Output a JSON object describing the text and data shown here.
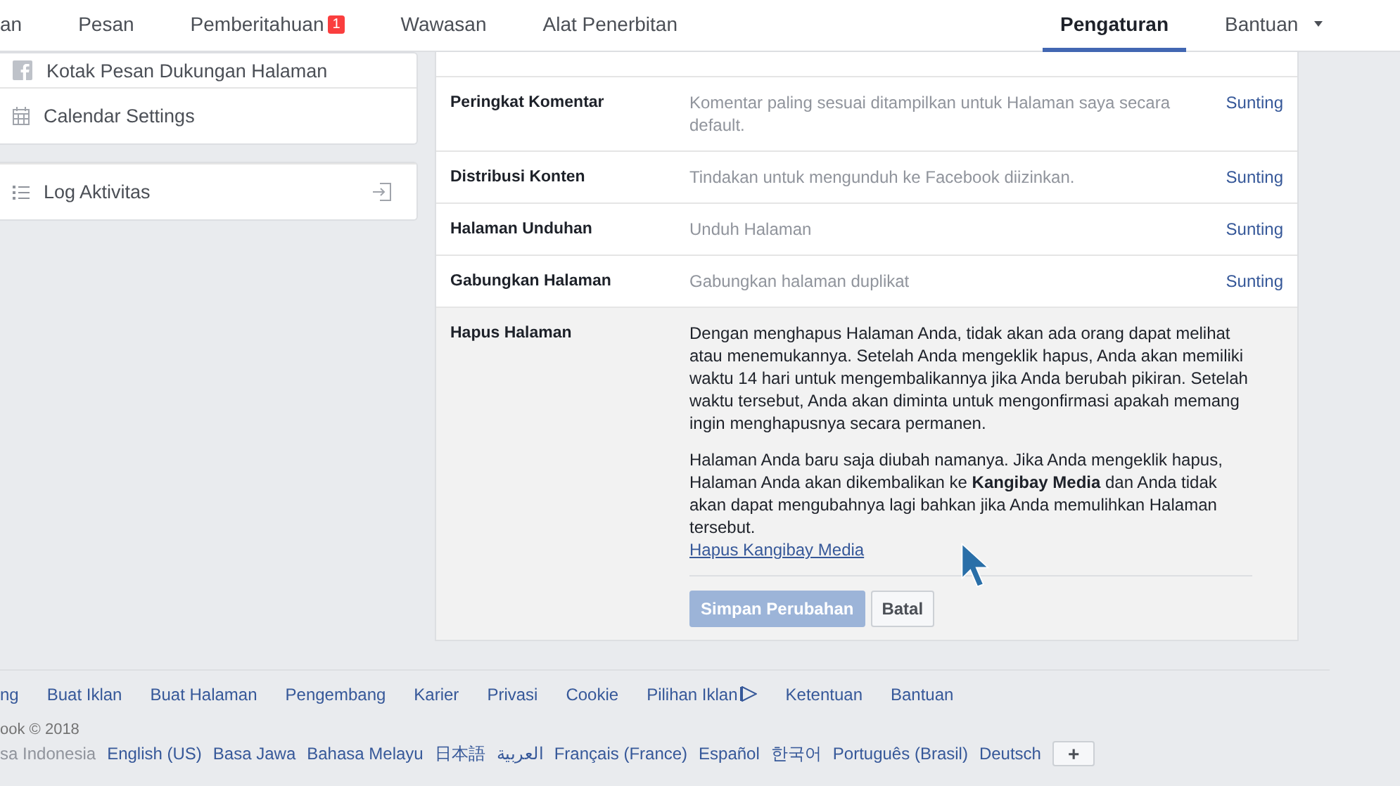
{
  "header": {
    "tabs": [
      {
        "label": "an",
        "selected": false,
        "kind": "link"
      },
      {
        "label": "Pesan",
        "selected": false,
        "kind": "link"
      },
      {
        "label": "Pemberitahuan",
        "selected": false,
        "kind": "link",
        "badge": "1"
      },
      {
        "label": "Wawasan",
        "selected": false,
        "kind": "link"
      },
      {
        "label": "Alat Penerbitan",
        "selected": false,
        "kind": "link"
      },
      {
        "label": "Pengaturan",
        "selected": true,
        "kind": "link"
      },
      {
        "label": "Bantuan",
        "selected": false,
        "kind": "dropdown"
      }
    ]
  },
  "sidebar": {
    "cards": [
      [
        {
          "label": "Kotak Pesan Dukungan Halaman"
        },
        {
          "label": "Calendar Settings"
        }
      ],
      [
        {
          "label": "Log Aktivitas"
        }
      ]
    ]
  },
  "settings": {
    "rows": [
      {
        "kind": "row",
        "label": "Peringkat Komentar",
        "description": "Komentar paling sesuai ditampilkan untuk Halaman saya secara default.",
        "action": "Sunting"
      },
      {
        "kind": "row",
        "label": "Distribusi Konten",
        "description": "Tindakan untuk mengunduh ke Facebook diizinkan.",
        "action": "Sunting"
      },
      {
        "kind": "row",
        "label": "Halaman Unduhan",
        "description": "Unduh Halaman",
        "action": "Sunting"
      },
      {
        "kind": "row",
        "label": "Gabungkan Halaman",
        "description": "Gabungkan halaman duplikat",
        "action": "Sunting"
      },
      {
        "kind": "expanded",
        "label": "Hapus Halaman",
        "paragraphs": [
          "Dengan menghapus Halaman Anda, tidak akan ada orang dapat melihat atau menemukannya. Setelah Anda mengeklik hapus, Anda akan memiliki waktu 14 hari untuk mengembalikannya jika Anda berubah pikiran. Setelah waktu tersebut, Anda akan diminta untuk mengonfirmasi apakah memang ingin menghapusnya secara permanen.",
          "Halaman Anda baru saja diubah namanya. Jika Anda mengeklik hapus, Halaman Anda akan dikembalikan ke **Kangibay Media** dan Anda tidak akan dapat mengubahnya lagi bahkan jika Anda memulihkan Halaman tersebut."
        ],
        "link": "Hapus Kangibay Media",
        "buttons": [
          {
            "label": "Simpan Perubahan",
            "disabled": true
          },
          {
            "label": "Batal",
            "disabled": false
          }
        ]
      }
    ]
  },
  "footer": {
    "links": [
      "ng",
      "Buat Iklan",
      "Buat Halaman",
      "Pengembang",
      "Karier",
      "Privasi",
      "Cookie",
      "Pilihan Iklan",
      "Ketentuan",
      "Bantuan"
    ],
    "copyright": "ook © 2018",
    "languages": [
      {
        "label": "sa Indonesia",
        "selected": true
      },
      {
        "label": "English (US)",
        "selected": false
      },
      {
        "label": "Basa Jawa",
        "selected": false
      },
      {
        "label": "Bahasa Melayu",
        "selected": false
      },
      {
        "label": "日本語",
        "selected": false
      },
      {
        "label": "العربية",
        "selected": false
      },
      {
        "label": "Français (France)",
        "selected": false
      },
      {
        "label": "Español",
        "selected": false
      },
      {
        "label": "한국어",
        "selected": false
      },
      {
        "label": "Português (Brasil)",
        "selected": false
      },
      {
        "label": "Deutsch",
        "selected": false
      }
    ],
    "more_button": "+"
  }
}
